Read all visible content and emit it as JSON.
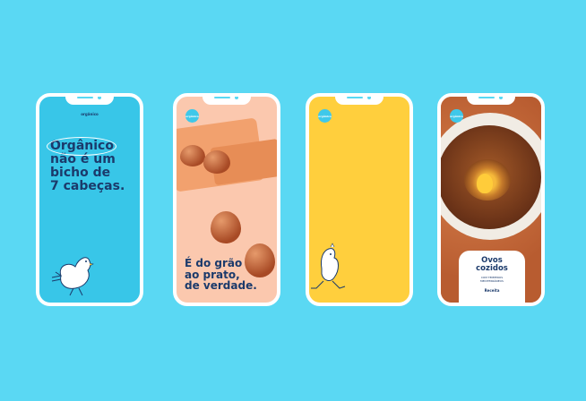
{
  "phones": [
    {
      "logo_text": "orgânico",
      "headline_lines": [
        "Orgânico",
        "não é um",
        "bicho de",
        "7 cabeças."
      ]
    },
    {
      "logo_text": "orgânico",
      "headline_lines": [
        "É do grão",
        "ao prato,",
        "de verdade."
      ]
    },
    {
      "logo_text": "orgânico"
    },
    {
      "logo_text": "orgânico",
      "card": {
        "title_lines": [
          "Ovos",
          "cozidos"
        ],
        "subtitle_lines": [
          "COM TEMPEROS",
          "MEDITERRÂNEOS"
        ],
        "footer": "Receita"
      }
    }
  ],
  "colors": {
    "background": "#5ad8f3",
    "phone1": "#38c6e8",
    "phone2": "#fbc8ae",
    "phone3": "#ffcf3d",
    "navy_text": "#1b3a6b"
  }
}
